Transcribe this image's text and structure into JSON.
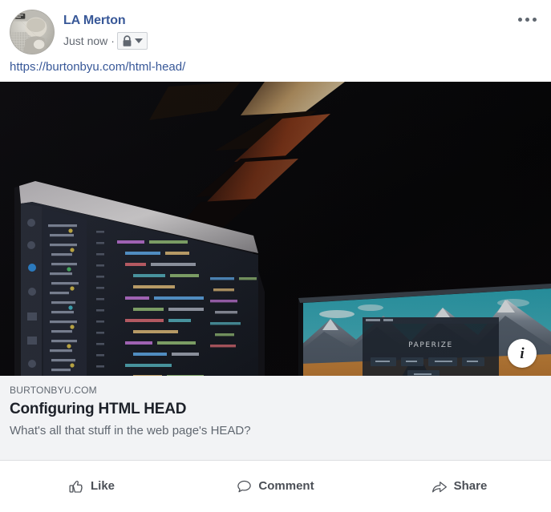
{
  "post": {
    "author": {
      "name": "LA Merton",
      "avatar_alt": "avatar"
    },
    "timestamp": "Just now",
    "separator": "·",
    "privacy": {
      "icon": "lock-icon",
      "chevron": "chevron-down-icon"
    },
    "menu": {
      "icon": "ellipsis-icon"
    },
    "link_text": "https://burtonbyu.com/html-head/",
    "attachment": {
      "image_alt": "Dark room with ultrawide monitor showing code editor and second monitor showing mountain road wallpaper",
      "info_badge": "i",
      "domain": "BURTONBYU.COM",
      "title": "Configuring HTML HEAD",
      "description": "What's all that stuff in the web page's HEAD?"
    },
    "actions": [
      {
        "label": "Like",
        "icon": "thumbs-up-icon"
      },
      {
        "label": "Comment",
        "icon": "comment-bubble-icon"
      },
      {
        "label": "Share",
        "icon": "share-arrow-icon"
      }
    ]
  },
  "colors": {
    "link_blue": "#385898",
    "text_dark": "#1d2129",
    "text_muted": "#606770",
    "footer_bg": "#f2f3f5",
    "border": "#dddfe2"
  }
}
